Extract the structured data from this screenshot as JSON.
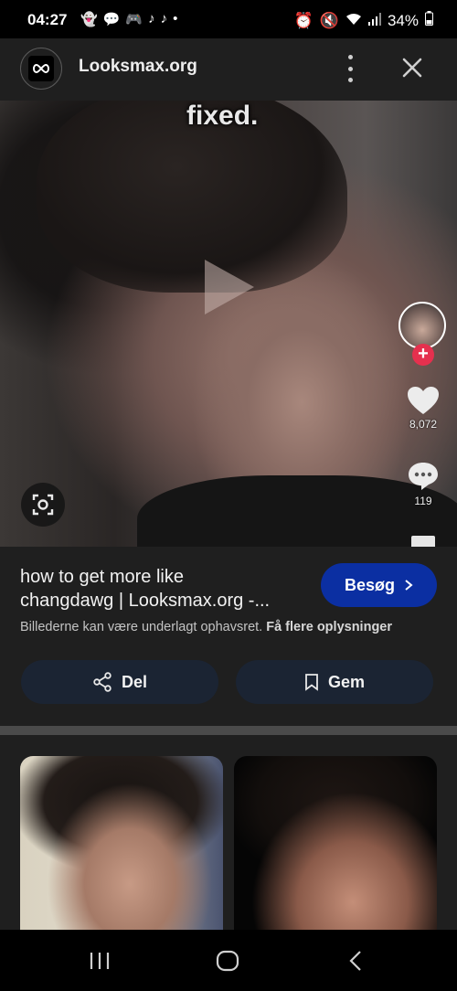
{
  "status_bar": {
    "time": "04:27",
    "notification_icons": [
      "snapchat-icon",
      "chat-icon",
      "discord-icon",
      "tiktok-icon",
      "tiktok-icon"
    ],
    "battery": "34%"
  },
  "header": {
    "site_name": "Looksmax.org"
  },
  "hero": {
    "caption": "fixed.",
    "likes": "8,072",
    "comments": "119"
  },
  "result": {
    "title_line1": "how to get more like",
    "title_line2": "changdawg | Looksmax.org -...",
    "visit_label": "Besøg",
    "copyright_text": "Billederne kan være underlagt ophavsret.",
    "more_info_label": "Få flere oplysninger",
    "share_label": "Del",
    "save_label": "Gem"
  },
  "colors": {
    "visit_button": "#0b2fa2",
    "action_button": "#1b2433",
    "background": "#1f1f1f"
  }
}
